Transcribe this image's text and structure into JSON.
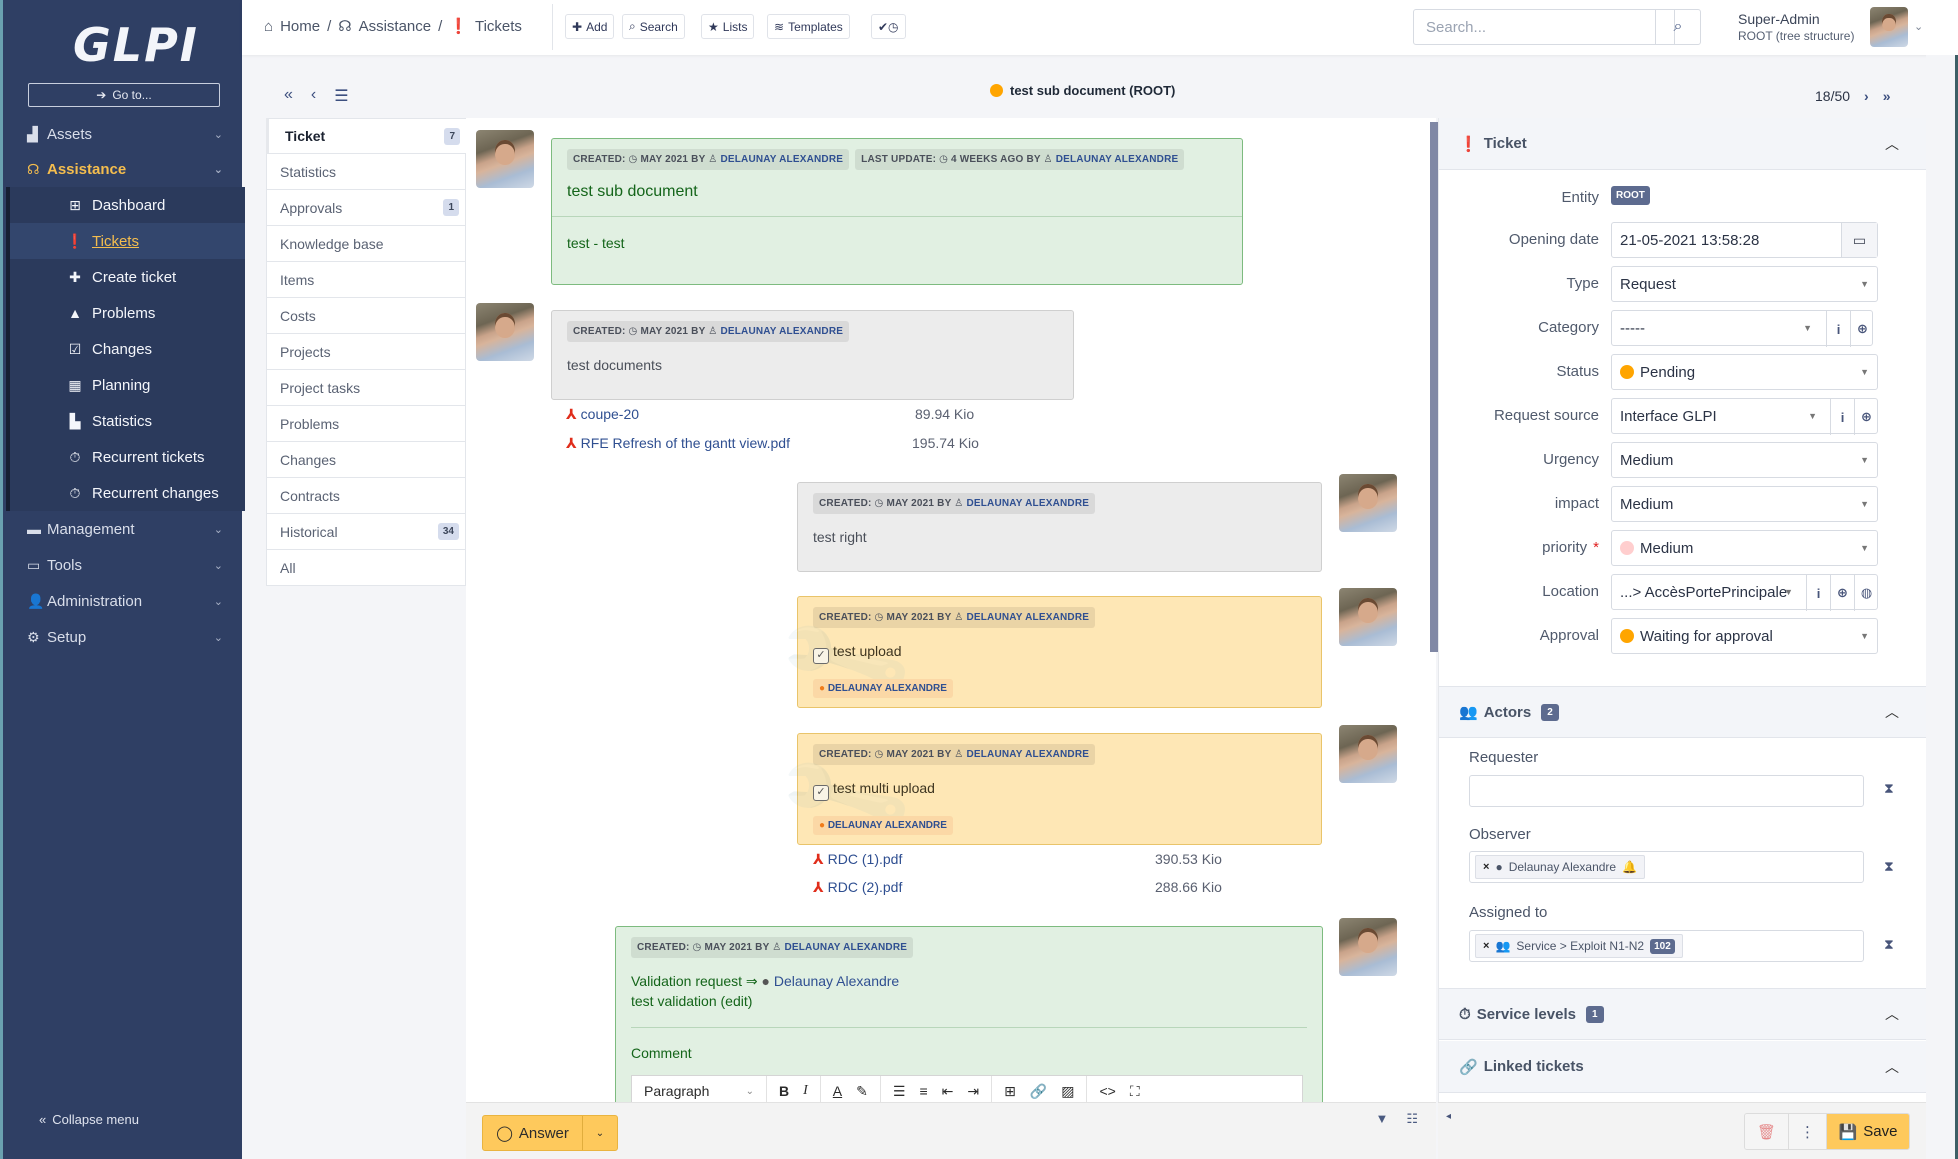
{
  "sidebar": {
    "logo": "GLPI",
    "goto_label": "Go to...",
    "top_items": [
      {
        "label": "Assets",
        "icon": "boxes-icon"
      },
      {
        "label": "Assistance",
        "icon": "headset-icon",
        "active": true
      }
    ],
    "sub_items": [
      {
        "label": "Dashboard",
        "icon": "dashboard-icon"
      },
      {
        "label": "Tickets",
        "icon": "exclamation-circle-icon",
        "active": true
      },
      {
        "label": "Create ticket",
        "icon": "plus-icon"
      },
      {
        "label": "Problems",
        "icon": "warning-icon"
      },
      {
        "label": "Changes",
        "icon": "clipboard-check-icon"
      },
      {
        "label": "Planning",
        "icon": "calendar-icon"
      },
      {
        "label": "Statistics",
        "icon": "bar-chart-icon"
      },
      {
        "label": "Recurrent tickets",
        "icon": "stopwatch-icon"
      },
      {
        "label": "Recurrent changes",
        "icon": "stopwatch-icon"
      }
    ],
    "bottom_items": [
      {
        "label": "Management",
        "icon": "wallet-icon"
      },
      {
        "label": "Tools",
        "icon": "toolbox-icon"
      },
      {
        "label": "Administration",
        "icon": "user-shield-icon"
      },
      {
        "label": "Setup",
        "icon": "cogs-icon"
      }
    ],
    "collapse_label": "Collapse menu"
  },
  "header": {
    "breadcrumb": [
      "Home",
      "Assistance",
      "Tickets"
    ],
    "toolbar": {
      "add": "Add",
      "search": "Search",
      "lists": "Lists",
      "templates": "Templates"
    },
    "search_placeholder": "Search...",
    "user_name": "Super-Admin",
    "user_entity": "ROOT (tree structure)"
  },
  "subheader": {
    "title": "test sub document (ROOT)",
    "status_color": "#ffa500",
    "pager": "18/50"
  },
  "tabs": [
    {
      "label": "Ticket",
      "badge": "7"
    },
    {
      "label": "Statistics"
    },
    {
      "label": "Approvals",
      "badge": "1"
    },
    {
      "label": "Knowledge base"
    },
    {
      "label": "Items"
    },
    {
      "label": "Costs"
    },
    {
      "label": "Projects"
    },
    {
      "label": "Project tasks"
    },
    {
      "label": "Problems"
    },
    {
      "label": "Changes"
    },
    {
      "label": "Contracts"
    },
    {
      "label": "Historical",
      "badge": "34"
    },
    {
      "label": "All"
    }
  ],
  "timeline": {
    "created_label": "Created:",
    "by_label": "by",
    "items": [
      {
        "type": "ticket",
        "created": "May 2021",
        "author": "Delaunay Alexandre",
        "last_update_label": "Last update:",
        "last_update": "4 weeks ago",
        "last_update_author": "Delaunay Alexandre",
        "title": "test sub document",
        "content": "test - test"
      },
      {
        "type": "document",
        "created": "May 2021",
        "author": "Delaunay Alexandre",
        "content": "test documents",
        "files": [
          {
            "name": "coupe-20",
            "size": "89.94 Kio"
          },
          {
            "name": "RFE Refresh of the gantt view.pdf",
            "size": "195.74 Kio"
          }
        ]
      },
      {
        "type": "followup",
        "created": "May 2021",
        "author": "Delaunay Alexandre",
        "content": "test right"
      },
      {
        "type": "task",
        "created": "May 2021",
        "author": "Delaunay Alexandre",
        "content": "test upload",
        "assignee": "Delaunay Alexandre"
      },
      {
        "type": "task",
        "created": "May 2021",
        "author": "Delaunay Alexandre",
        "content": "test multi upload",
        "assignee": "Delaunay Alexandre",
        "files": [
          {
            "name": "RDC (1).pdf",
            "size": "390.53 Kio"
          },
          {
            "name": "RDC (2).pdf",
            "size": "288.66 Kio"
          }
        ]
      },
      {
        "type": "validation",
        "created": "May 2021",
        "author": "Delaunay Alexandre",
        "request_label": "Validation request ⇒",
        "validator": "Delaunay Alexandre",
        "content": "test validation (edit)",
        "comment_label": "Comment",
        "editor_format": "Paragraph"
      }
    ]
  },
  "actions": {
    "answer_label": "Answer",
    "save_label": "Save"
  },
  "ticket_panel": {
    "title": "Ticket",
    "fields": {
      "entity": {
        "label": "Entity",
        "value": "ROOT"
      },
      "opening_date": {
        "label": "Opening date",
        "value": "21-05-2021 13:58:28"
      },
      "type": {
        "label": "Type",
        "value": "Request"
      },
      "category": {
        "label": "Category",
        "value": "-----"
      },
      "status": {
        "label": "Status",
        "value": "Pending",
        "color": "#ffa500"
      },
      "request_source": {
        "label": "Request source",
        "value": "Interface GLPI"
      },
      "urgency": {
        "label": "Urgency",
        "value": "Medium"
      },
      "impact": {
        "label": "impact",
        "value": "Medium"
      },
      "priority": {
        "label": "priority",
        "required_mark": "*",
        "value": "Medium",
        "color": "#ffcece"
      },
      "location": {
        "label": "Location",
        "value": "...> AccèsPortePrincipale"
      },
      "approval": {
        "label": "Approval",
        "value": "Waiting for approval",
        "color": "#ffa500"
      }
    }
  },
  "actors_panel": {
    "title": "Actors",
    "count": "2",
    "requester_label": "Requester",
    "observer_label": "Observer",
    "observer_value": "Delaunay Alexandre",
    "assigned_label": "Assigned to",
    "assigned_value": "Service > Exploit N1-N2",
    "assigned_count": "102"
  },
  "service_levels": {
    "title": "Service levels",
    "count": "1"
  },
  "linked_tickets": {
    "title": "Linked tickets"
  }
}
